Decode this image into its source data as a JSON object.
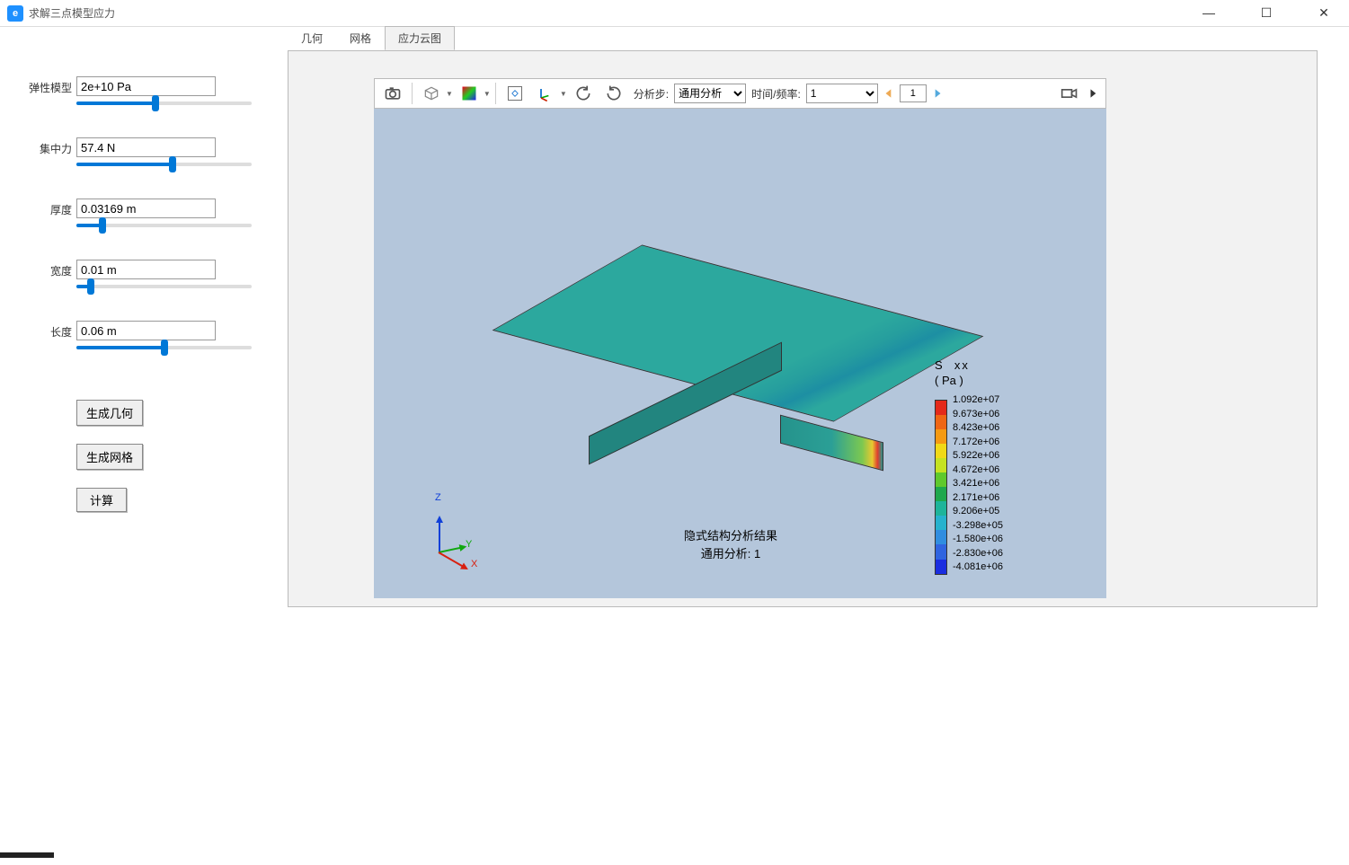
{
  "window": {
    "title": "求解三点模型应力"
  },
  "params": [
    {
      "label": "弹性模型",
      "value": "2e+10 Pa",
      "slider": 45
    },
    {
      "label": "集中力",
      "value": "57.4 N",
      "slider": 55
    },
    {
      "label": "厚度",
      "value": "0.03169 m",
      "slider": 15
    },
    {
      "label": "宽度",
      "value": "0.01 m",
      "slider": 8
    },
    {
      "label": "长度",
      "value": "0.06 m",
      "slider": 50
    }
  ],
  "buttons": {
    "genGeom": "生成几何",
    "genMesh": "生成网格",
    "compute": "计算"
  },
  "tabs": {
    "geom": "几何",
    "mesh": "网格",
    "contour": "应力云图"
  },
  "toolbar": {
    "stepLabel": "分析步:",
    "stepSelect": "通用分析",
    "timeLabel": "时间/频率:",
    "timeSelect": "1",
    "frameNum": "1"
  },
  "axes": {
    "x": "X",
    "y": "Y",
    "z": "Z"
  },
  "result": {
    "line1": "隐式结构分析结果",
    "line2": "通用分析: 1"
  },
  "legend": {
    "title": "S  xx",
    "unit": "( Pa )",
    "segments": [
      {
        "color": "#e42a1a",
        "value": "1.092e+07"
      },
      {
        "color": "#ef6614",
        "value": "9.673e+06"
      },
      {
        "color": "#f59a12",
        "value": "8.423e+06"
      },
      {
        "color": "#f0d917",
        "value": "7.172e+06"
      },
      {
        "color": "#c5e221",
        "value": "5.922e+06"
      },
      {
        "color": "#5fc92c",
        "value": "4.672e+06"
      },
      {
        "color": "#1fa84d",
        "value": "3.421e+06"
      },
      {
        "color": "#1eb49a",
        "value": "2.171e+06"
      },
      {
        "color": "#26b2cd",
        "value": "9.206e+05"
      },
      {
        "color": "#2f8de0",
        "value": "-3.298e+05"
      },
      {
        "color": "#2f64e0",
        "value": "-1.580e+06"
      },
      {
        "color": "#1a2de0",
        "value": "-2.830e+06"
      }
    ],
    "last": "-4.081e+06"
  }
}
